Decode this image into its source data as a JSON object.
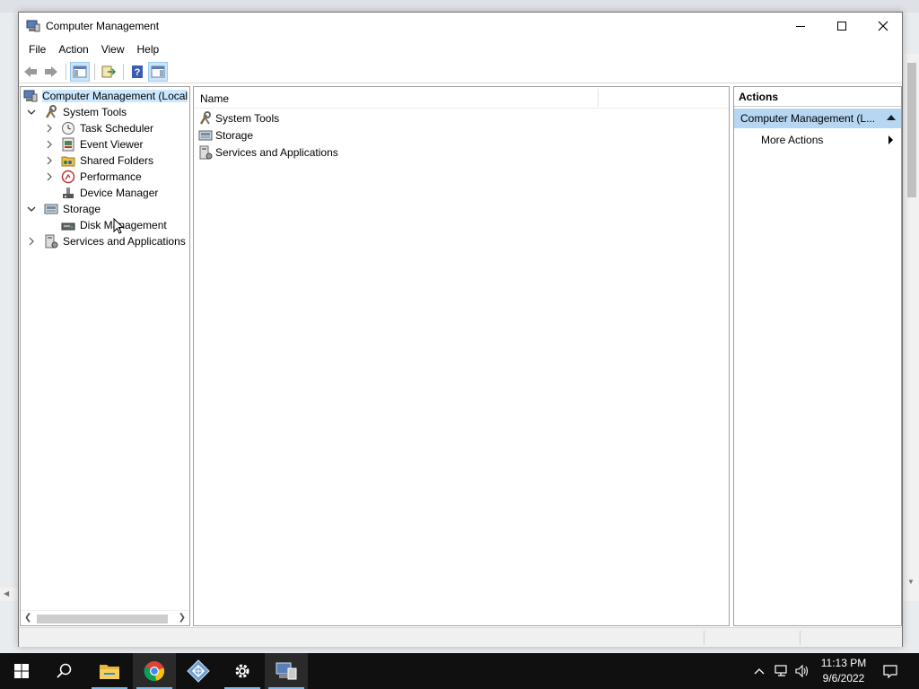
{
  "window": {
    "title": "Computer Management",
    "controls": {
      "minimize": "minimize",
      "maximize": "maximize",
      "close": "close"
    }
  },
  "menu": [
    "File",
    "Action",
    "View",
    "Help"
  ],
  "toolbar": {
    "buttons": [
      "back-arrow-icon",
      "forward-arrow-icon",
      "show-hide-console-tree-icon",
      "export-list-icon",
      "help-icon",
      "show-hide-action-pane-icon"
    ]
  },
  "tree": {
    "root": "Computer Management (Local",
    "system_tools": "System Tools",
    "task_scheduler": "Task Scheduler",
    "event_viewer": "Event Viewer",
    "shared_folders": "Shared Folders",
    "performance": "Performance",
    "device_manager": "Device Manager",
    "storage": "Storage",
    "disk_management": "Disk Management",
    "services_apps": "Services and Applications"
  },
  "center": {
    "column_name": "Name",
    "items": [
      "System Tools",
      "Storage",
      "Services and Applications"
    ]
  },
  "actions": {
    "header": "Actions",
    "section": "Computer Management (L...",
    "more": "More Actions"
  },
  "taskbar": {
    "apps": [
      "start-icon",
      "search-icon",
      "file-explorer-icon",
      "chrome-icon",
      "remote-app-icon",
      "settings-icon",
      "computer-management-icon"
    ],
    "time": "11:13 PM",
    "date": "9/6/2022"
  }
}
